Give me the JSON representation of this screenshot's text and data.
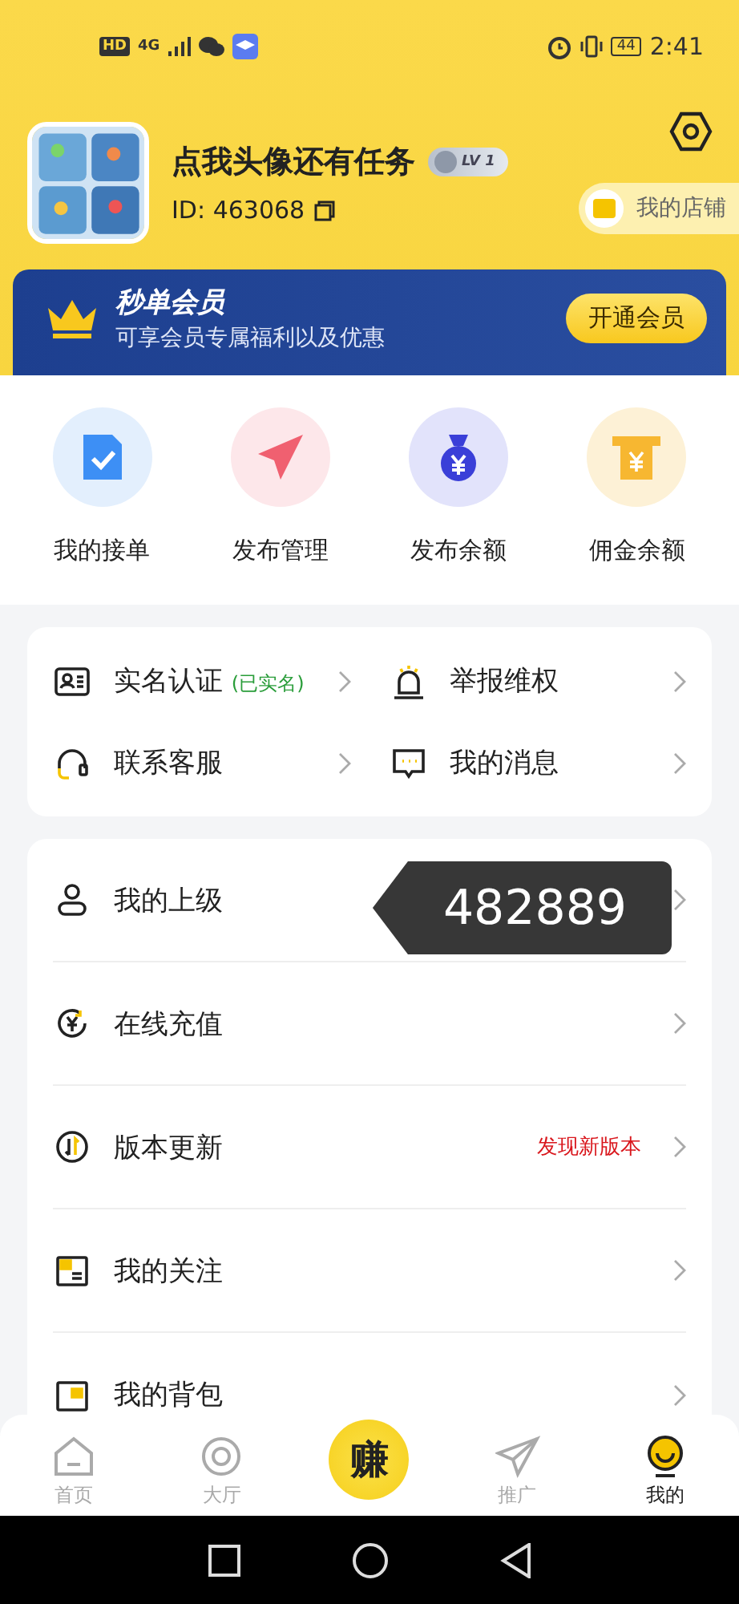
{
  "status_bar": {
    "network": [
      "HD",
      "4G"
    ],
    "battery": "44",
    "time": "2:41"
  },
  "profile": {
    "name": "点我头像还有任务",
    "level_badge": "LV 1",
    "id_label": "ID:",
    "id": "463068",
    "store_button": "我的店铺"
  },
  "membership": {
    "title": "秒单会员",
    "subtitle": "可享会员专属福利以及优惠",
    "button": "开通会员"
  },
  "shortcuts": [
    {
      "kind": "orders",
      "label": "我的接单"
    },
    {
      "kind": "publish",
      "label": "发布管理"
    },
    {
      "kind": "moneybag",
      "label": "发布余额"
    },
    {
      "kind": "atm",
      "label": "佣金余额"
    }
  ],
  "services": [
    {
      "kind": "id_card",
      "label": "实名认证",
      "note": "(已实名)"
    },
    {
      "kind": "alarm",
      "label": "举报维权"
    },
    {
      "kind": "headset",
      "label": "联系客服"
    },
    {
      "kind": "message",
      "label": "我的消息"
    }
  ],
  "menu": [
    {
      "kind": "person",
      "label": "我的上级"
    },
    {
      "kind": "recharge",
      "label": "在线充值"
    },
    {
      "kind": "update",
      "label": "版本更新",
      "note": "发现新版本"
    },
    {
      "kind": "follow",
      "label": "我的关注"
    },
    {
      "kind": "bag",
      "label": "我的背包"
    }
  ],
  "tooltip": {
    "text": "482889"
  },
  "tabs": [
    {
      "kind": "home",
      "label": "首页",
      "selected": false
    },
    {
      "kind": "hall",
      "label": "大厅",
      "selected": false
    },
    {
      "kind": "earn",
      "label": "赚",
      "selected": false
    },
    {
      "kind": "promote",
      "label": "推广",
      "selected": false
    },
    {
      "kind": "me",
      "label": "我的",
      "selected": true
    }
  ]
}
